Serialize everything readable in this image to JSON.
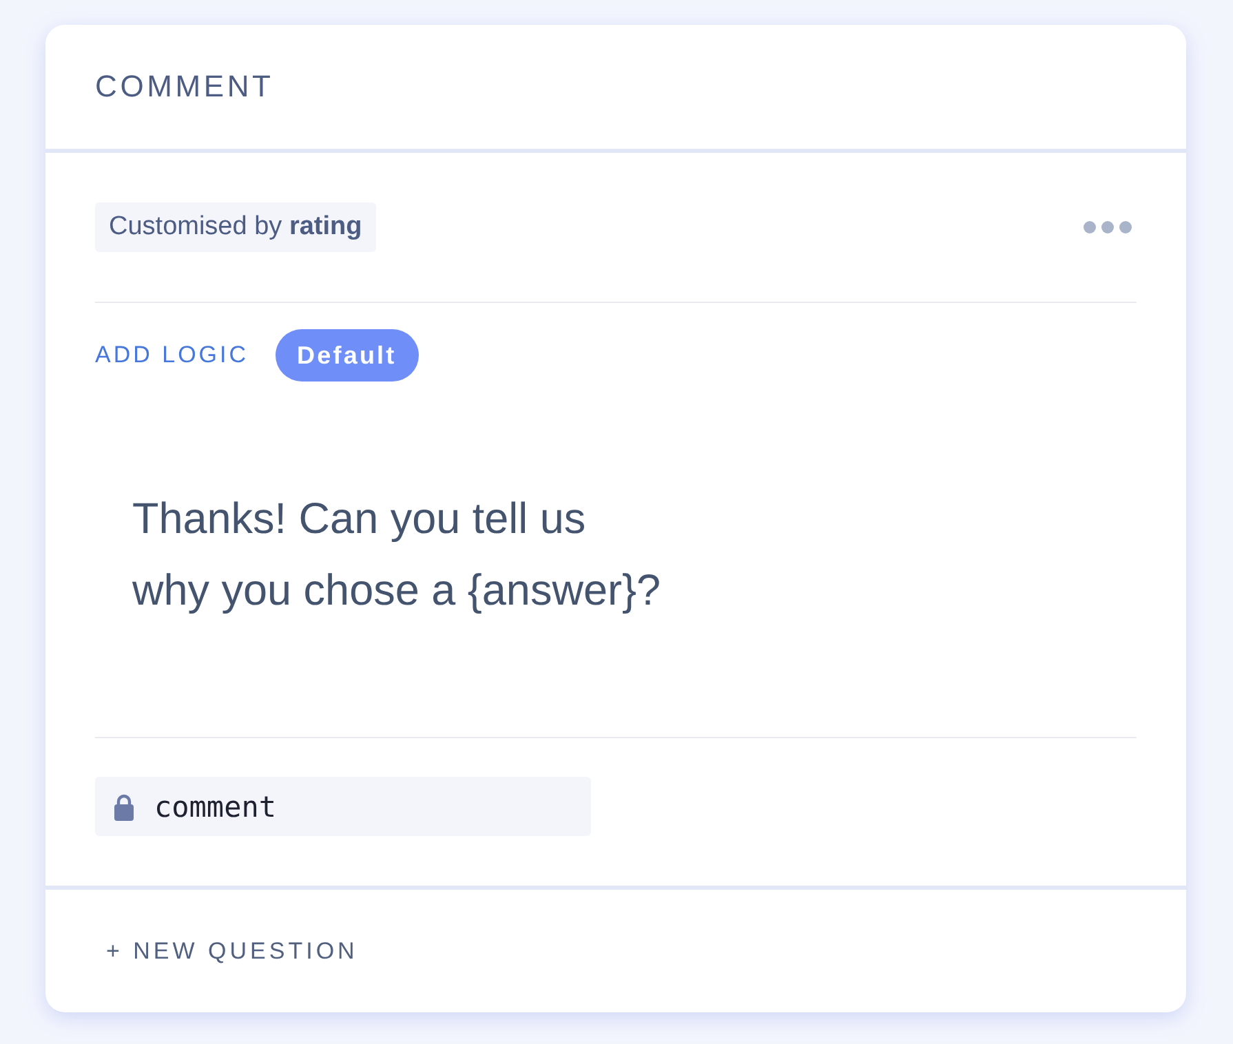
{
  "card": {
    "title": "COMMENT",
    "customised": "Customised by **rating**",
    "add_logic": "ADD LOGIC",
    "badge": "Default",
    "question": "Thanks! Can you tell us\nwhy you chose a {answer}?",
    "variable": {
      "value": "comment",
      "locked": true
    },
    "new_question": "+ NEW QUESTION"
  }
}
